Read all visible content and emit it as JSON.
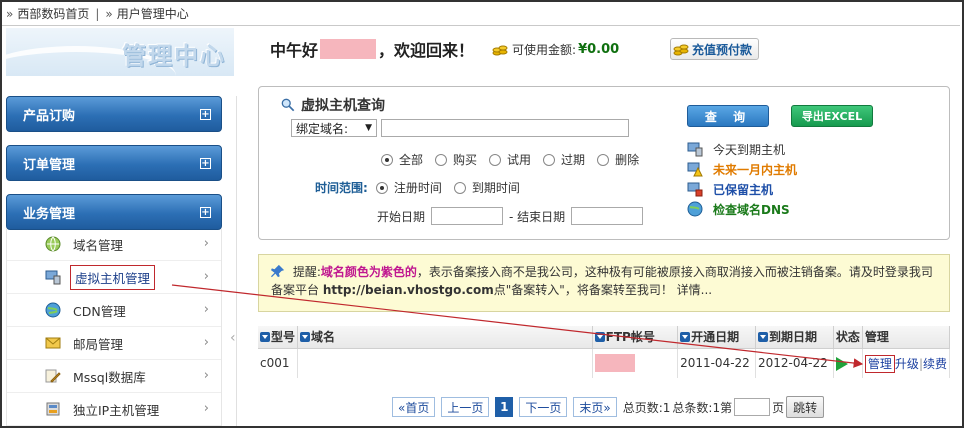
{
  "breadcrumb": {
    "home": "西部数码首页",
    "current": "用户管理中心"
  },
  "logo": {
    "text": "管理中心"
  },
  "greeting": {
    "hello": "中午好",
    "welcome": "，欢迎回来！",
    "balance_label": "可使用金额:",
    "balance_value": "¥0.00"
  },
  "recharge": {
    "label": "充值预付款"
  },
  "sidebar": {
    "categories": [
      {
        "label": "产品订购"
      },
      {
        "label": "订单管理"
      },
      {
        "label": "业务管理"
      }
    ],
    "items": [
      {
        "label": "域名管理",
        "icon": "globe-icon"
      },
      {
        "label": "虚拟主机管理",
        "icon": "server-monitor-icon"
      },
      {
        "label": "CDN管理",
        "icon": "cdn-globe-icon"
      },
      {
        "label": "邮局管理",
        "icon": "mail-icon"
      },
      {
        "label": "Mssql数据库",
        "icon": "database-pencil-icon"
      },
      {
        "label": "独立IP主机管理",
        "icon": "server-ip-icon"
      }
    ]
  },
  "search": {
    "title": "虚拟主机查询",
    "bind_select": "绑定域名:",
    "status_options": [
      "全部",
      "购买",
      "试用",
      "过期",
      "删除"
    ],
    "status_selected": "全部",
    "time_label": "时间范围:",
    "time_options": [
      "注册时间",
      "到期时间"
    ],
    "time_selected": "注册时间",
    "start_label": "开始日期",
    "end_label": "- 结束日期",
    "query_button": "查 询",
    "export_button": "导出EXCEL",
    "quick_links": [
      "今天到期主机",
      "未来一月内主机",
      "已保留主机",
      "检查域名DNS"
    ]
  },
  "notice": {
    "lead": "提醒:",
    "highlight": "域名颜色为紫色的",
    "body1": "，表示备案接入商不是我公司，这种极有可能被原接入商取消接入而被注销备案。请及时登录我司备案平台 ",
    "url": "http://beian.vhostgo.com",
    "body2": "点\"备案转入\"，将备案转至我司！ 详情...",
    "details": ""
  },
  "table": {
    "headers": [
      "型号",
      "域名",
      "FTP帐号",
      "开通日期",
      "到期日期",
      "状态",
      "管理"
    ],
    "rows": [
      {
        "model": "c001",
        "domain": "",
        "ftp": "",
        "open_date": "2011-04-22",
        "expire_date": "2012-04-22",
        "actions": [
          "管理",
          "升级",
          "续费"
        ]
      }
    ]
  },
  "pager": {
    "first": "«首页",
    "prev": "上一页",
    "current": "1",
    "next": "下一页",
    "last": "末页»",
    "total_pages": "总页数:1",
    "total_items": "总条数:1",
    "goto_prefix": "第",
    "goto_suffix": "页",
    "go_button": "跳转"
  },
  "colors": {
    "accent": "#2c6fb5",
    "purple_domain": "#c01890",
    "notice_bg": "#fdfbd4",
    "redacted": "#f6b6bd"
  }
}
